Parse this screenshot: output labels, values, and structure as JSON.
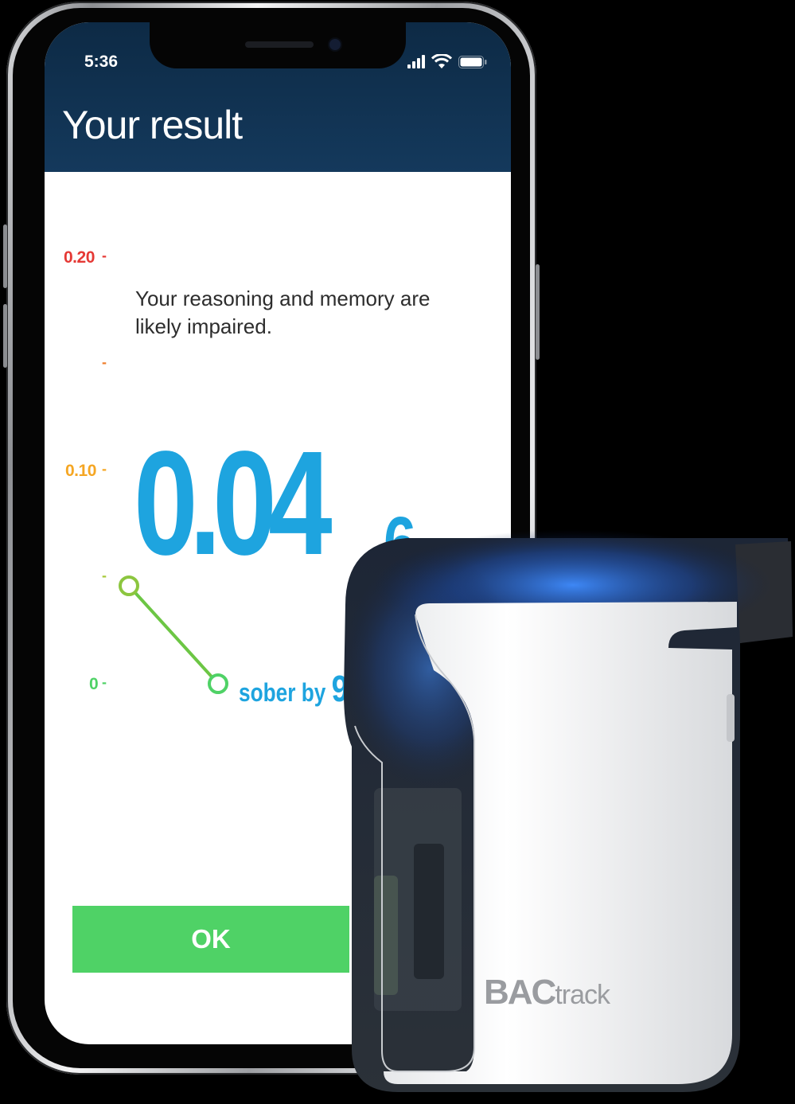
{
  "status_bar": {
    "time": "5:36"
  },
  "header": {
    "title": "Your result"
  },
  "scale": {
    "ticks": [
      {
        "label": "0.20",
        "color": "#e53935"
      },
      {
        "label": "0.10",
        "color": "#f5a623"
      },
      {
        "label": "0",
        "color": "#4fd266"
      }
    ]
  },
  "result": {
    "message": "Your reasoning and memory are likely impaired.",
    "bac_main": "0.04",
    "bac_sub": "6",
    "sober_prefix": "sober by",
    "sober_time": "9"
  },
  "actions": {
    "ok_label": "OK"
  },
  "device": {
    "brand_bold": "BAC",
    "brand_light": "track"
  },
  "colors": {
    "header": "#12355a",
    "accent_blue": "#1ea4df",
    "ok_green": "#4fd266",
    "line_green": "#6cc644"
  }
}
